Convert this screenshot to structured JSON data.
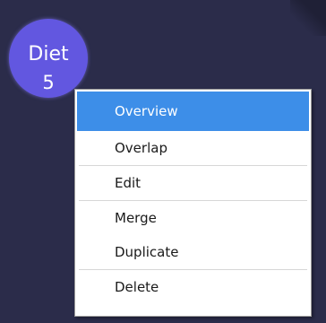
{
  "node": {
    "label": "Diet",
    "count": "5",
    "color": "#6257e0"
  },
  "context_menu": {
    "highlight_color": "#3d8ee8",
    "groups": [
      [
        {
          "label": "Overview",
          "highlighted": true
        },
        {
          "label": "Overlap",
          "highlighted": false
        }
      ],
      [
        {
          "label": "Edit",
          "highlighted": false
        }
      ],
      [
        {
          "label": "Merge",
          "highlighted": false
        },
        {
          "label": "Duplicate",
          "highlighted": false
        }
      ],
      [
        {
          "label": "Delete",
          "highlighted": false
        }
      ]
    ]
  }
}
